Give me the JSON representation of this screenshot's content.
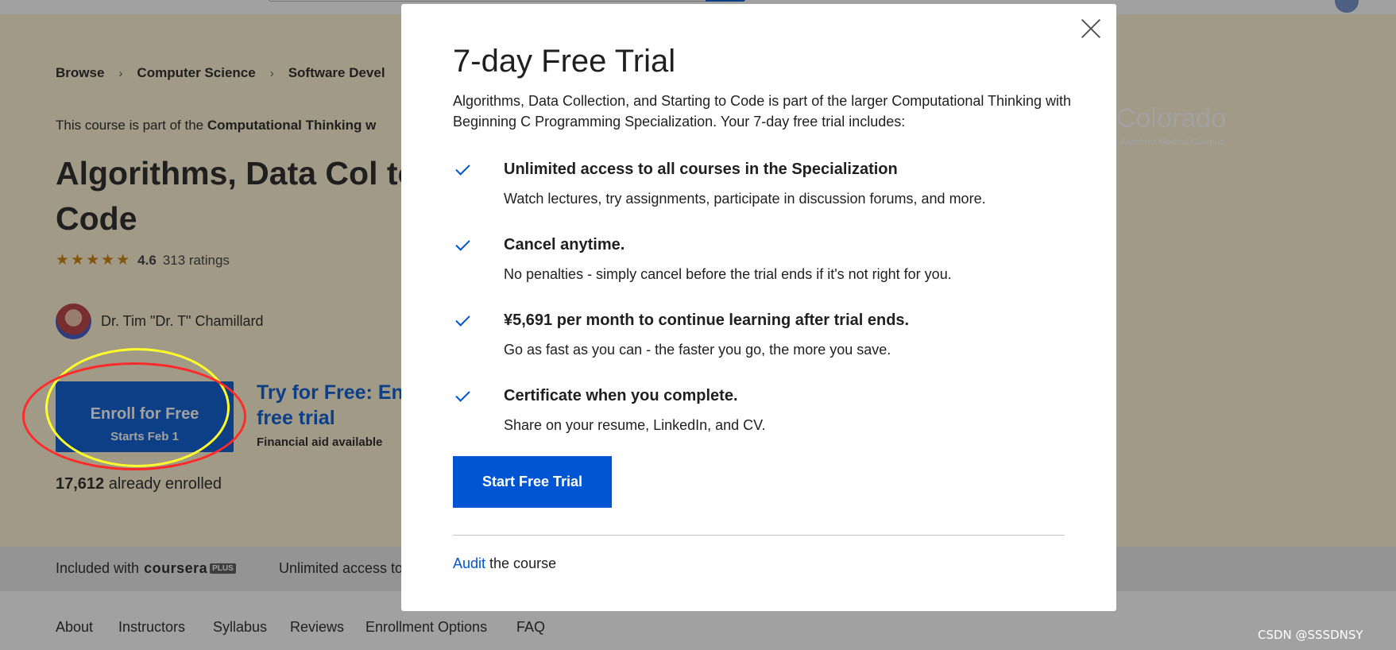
{
  "breadcrumb": [
    "Browse",
    "Computer Science",
    "Software Devel"
  ],
  "hero": {
    "part_of_prefix": "This course is part of the ",
    "part_of_name": "Computational Thinking w",
    "title": "Algorithms, Data Col to Code",
    "rating": "4.6",
    "ratings_count": "313 ratings",
    "stars": "★★★★★",
    "instructor": "Dr. Tim \"Dr. T\" Chamillard",
    "enroll_label": "Enroll for Free",
    "enroll_sub": "Starts Feb 1",
    "trial_text_line1": "Try for Free: En",
    "trial_text_line2": "free trial",
    "financial_aid": "Financial aid available",
    "enrolled_count": "17,612",
    "enrolled_suffix": " already enrolled",
    "university_name": "Colorado",
    "university_campus": "| Anschutz Medical Campus"
  },
  "plus_bar": {
    "included_with": "Included with",
    "logo_text": "coursera",
    "badge": "PLUS",
    "unlimited": "Unlimited access to"
  },
  "nav_tabs": [
    "About",
    "Instructors",
    "Syllabus",
    "Reviews",
    "Enrollment Options",
    "FAQ"
  ],
  "modal": {
    "title": "7-day Free Trial",
    "description": "Algorithms, Data Collection, and Starting to Code is part of the larger Computational Thinking with Beginning C Programming Specialization. Your 7-day free trial includes:",
    "benefits": [
      {
        "title": "Unlimited access to all courses in the Specialization",
        "desc": "Watch lectures, try assignments, participate in discussion forums, and more."
      },
      {
        "title": "Cancel anytime.",
        "desc": "No penalties - simply cancel before the trial ends if it's not right for you."
      },
      {
        "title": "¥5,691 per month to continue learning after trial ends.",
        "desc": "Go as fast as you can - the faster you go, the more you save."
      },
      {
        "title": "Certificate when you complete.",
        "desc": "Share on your resume, LinkedIn, and CV."
      }
    ],
    "start_button": "Start Free Trial",
    "audit_link": "Audit",
    "audit_suffix": " the course"
  },
  "watermark": "CSDN @SSSDNSY",
  "colors": {
    "accent": "#0056d2",
    "annotation_yellow": "#ffff2a",
    "annotation_red": "#ff2a2a"
  },
  "icons": [
    "close-icon",
    "check-icon",
    "star-icon"
  ]
}
